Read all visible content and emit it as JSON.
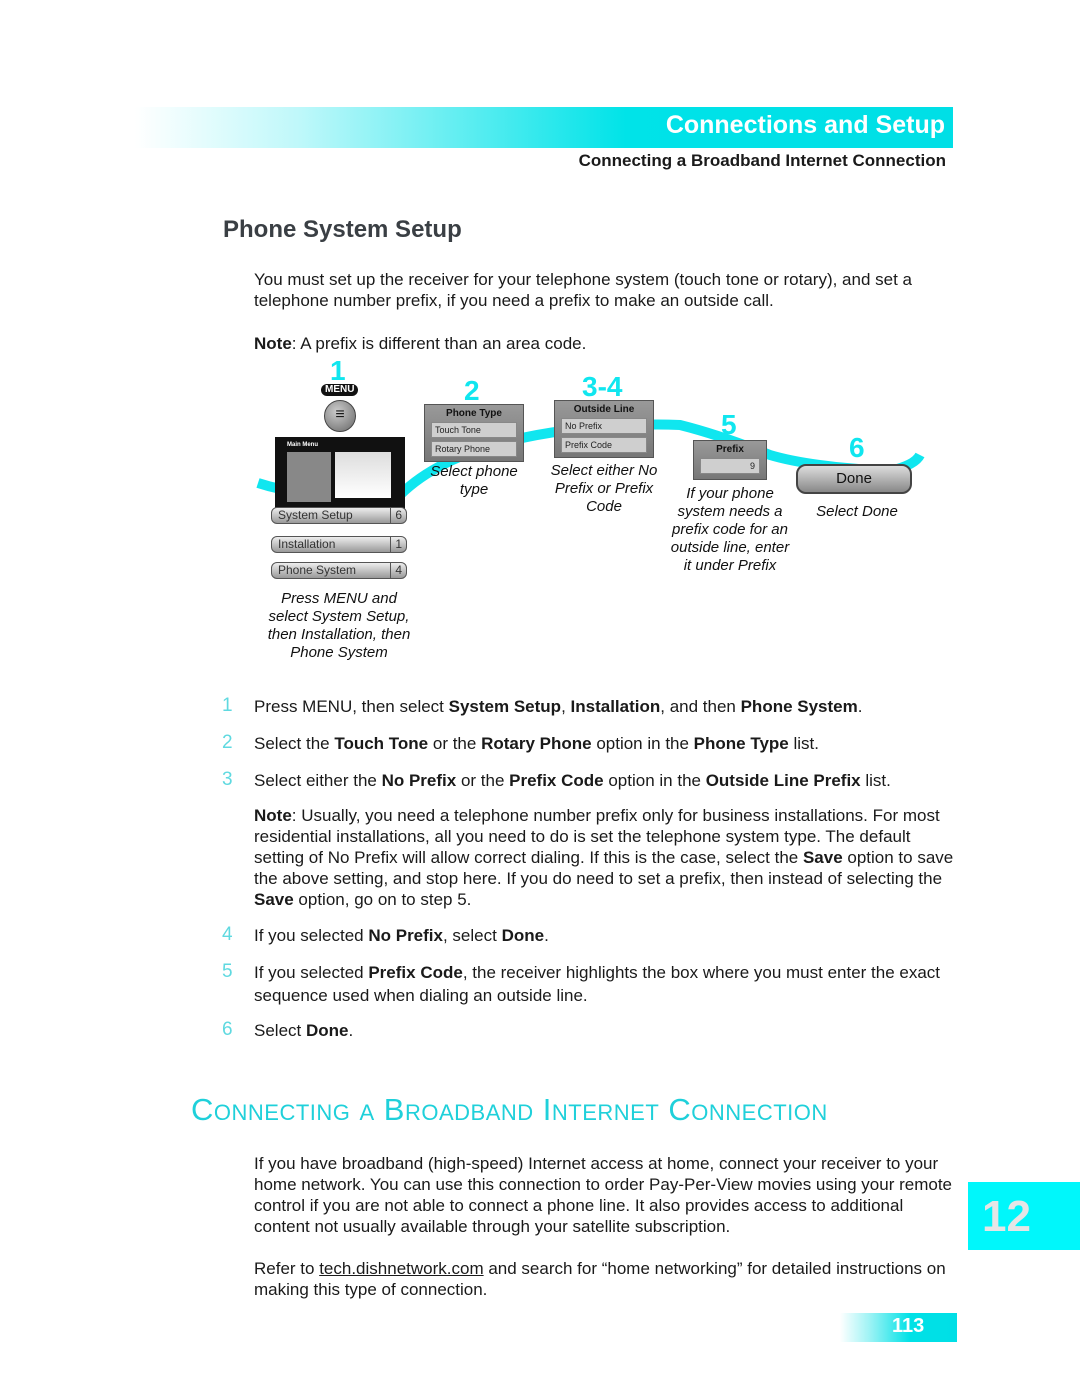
{
  "header": {
    "section": "Connections and Setup",
    "subsection": "Connecting a Broadband Internet Connection"
  },
  "title": "Phone System Setup",
  "intro": "You must set up the receiver for your telephone system (touch tone or rotary), and set a telephone number prefix, if you need a prefix to make an outside call.",
  "note1": [
    {
      "t": "Note",
      "b": true
    },
    {
      "t": ": A prefix is different than an area code."
    }
  ],
  "diagram": {
    "accent": "#10e6ef",
    "step1": {
      "num": "1",
      "menu": "MENU",
      "screen_title": "Main Menu",
      "items": [
        {
          "label": "System Setup",
          "num": "6"
        },
        {
          "label": "Installation",
          "num": "1"
        },
        {
          "label": "Phone System",
          "num": "4"
        }
      ],
      "caption": "Press MENU and select System Setup, then Installation, then Phone System"
    },
    "step2": {
      "num": "2",
      "box_title": "Phone Type",
      "options": [
        "Touch Tone",
        "Rotary Phone"
      ],
      "caption": "Select phone type"
    },
    "step34": {
      "num": "3-4",
      "box_title": "Outside Line",
      "options": [
        "No Prefix",
        "Prefix Code"
      ],
      "caption": "Select either No Prefix or Prefix Code"
    },
    "step5": {
      "num": "5",
      "box_title": "Prefix",
      "value": "9",
      "caption": "If your phone system needs a prefix code for an outside line, enter it under Prefix"
    },
    "step6": {
      "num": "6",
      "button": "Done",
      "caption": "Select Done"
    }
  },
  "steps": [
    {
      "n": "1",
      "segs": [
        {
          "t": "Press MENU, then select "
        },
        {
          "t": "System Setup",
          "b": true
        },
        {
          "t": ", "
        },
        {
          "t": "Installation",
          "b": true
        },
        {
          "t": ", and then "
        },
        {
          "t": "Phone System",
          "b": true
        },
        {
          "t": "."
        }
      ]
    },
    {
      "n": "2",
      "segs": [
        {
          "t": "Select the "
        },
        {
          "t": "Touch Tone",
          "b": true
        },
        {
          "t": " or the "
        },
        {
          "t": "Rotary Phone",
          "b": true
        },
        {
          "t": " option in the "
        },
        {
          "t": "Phone Type",
          "b": true
        },
        {
          "t": " list."
        }
      ]
    },
    {
      "n": "3",
      "segs": [
        {
          "t": "Select either the "
        },
        {
          "t": "No Prefix",
          "b": true
        },
        {
          "t": " or the "
        },
        {
          "t": "Prefix Code",
          "b": true
        },
        {
          "t": " option in the "
        },
        {
          "t": "Outside Line Prefix",
          "b": true
        },
        {
          "t": " list."
        }
      ]
    },
    {
      "n": "4",
      "segs": [
        {
          "t": "If you selected "
        },
        {
          "t": "No Prefix",
          "b": true
        },
        {
          "t": ", select "
        },
        {
          "t": "Done",
          "b": true
        },
        {
          "t": "."
        }
      ]
    },
    {
      "n": "5",
      "segs": [
        {
          "t": "If you selected "
        },
        {
          "t": "Prefix Code",
          "b": true
        },
        {
          "t": ", the receiver highlights the box where you must enter the exact sequence used when dialing an outside line."
        }
      ]
    },
    {
      "n": "6",
      "segs": [
        {
          "t": "Select "
        },
        {
          "t": "Done",
          "b": true
        },
        {
          "t": "."
        }
      ]
    }
  ],
  "note2": [
    {
      "t": "Note",
      "b": true
    },
    {
      "t": ": Usually, you need a telephone number prefix only for business installations. For most residential installations, all you need to do is set the telephone system type. The default setting of No Prefix will allow correct dialing. If this is the case, select the "
    },
    {
      "t": "Save",
      "b": true
    },
    {
      "t": " option to save the above setting, and stop here. If you do need to set a prefix, then instead of selecting the "
    },
    {
      "t": "Save",
      "b": true
    },
    {
      "t": " option, go on to step 5."
    }
  ],
  "broadband": {
    "heading": "Connecting a Broadband Internet Connection",
    "para": "If you have broadband (high-speed) Internet access at home, connect your receiver to your home network. You can use this connection to order Pay-Per-View movies using your remote control if you are not able to connect a phone line. It also provides access to additional content not usually available through your satellite subscription.",
    "refer_pre": "Refer to ",
    "refer_link": "tech.dishnetwork.com",
    "refer_post": " and search for “home networking” for detailed instructions on making this type of connection."
  },
  "chapter_tab": "12",
  "page_number": "113"
}
